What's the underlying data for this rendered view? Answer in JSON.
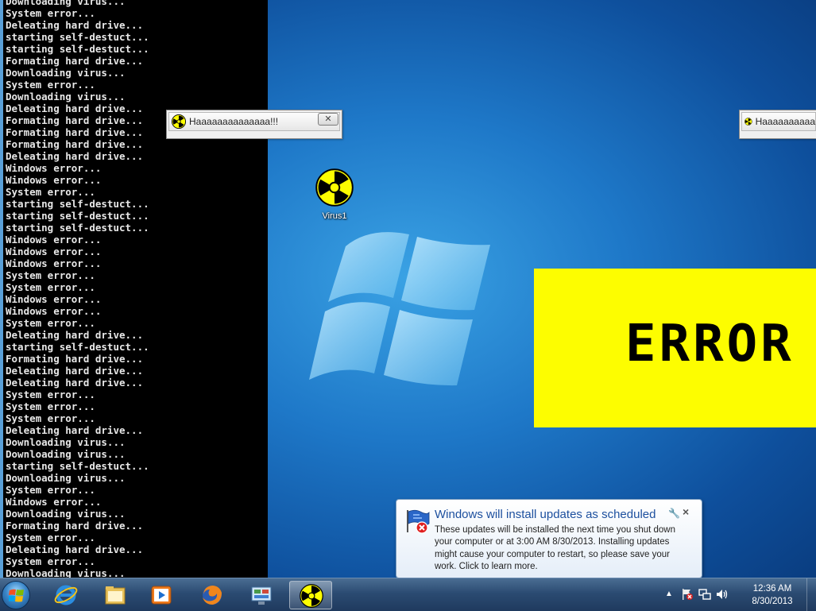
{
  "console": {
    "lines": [
      "Downloading virus...",
      "System error...",
      "Deleating hard drive...",
      "starting self-destuct...",
      "starting self-destuct...",
      "Formating hard drive...",
      "Downloading virus...",
      "System error...",
      "Downloading virus...",
      "Deleating hard drive...",
      "Formating hard drive...",
      "Formating hard drive...",
      "Formating hard drive...",
      "Deleating hard drive...",
      "Windows error...",
      "Windows error...",
      "System error...",
      "starting self-destuct...",
      "starting self-destuct...",
      "starting self-destuct...",
      "Windows error...",
      "Windows error...",
      "Windows error...",
      "System error...",
      "System error...",
      "Windows error...",
      "Windows error...",
      "System error...",
      "Deleating hard drive...",
      "starting self-destuct...",
      "Formating hard drive...",
      "Deleating hard drive...",
      "Deleating hard drive...",
      "System error...",
      "System error...",
      "System error...",
      "Deleating hard drive...",
      "Downloading virus...",
      "Downloading virus...",
      "starting self-destuct...",
      "Downloading virus...",
      "System error...",
      "Windows error...",
      "Downloading virus...",
      "Formating hard drive...",
      "System error...",
      "Deleating hard drive...",
      "System error...",
      "Downloading virus..."
    ]
  },
  "popups": [
    {
      "text": "Haaaaaaaaaaaaaa!!!"
    },
    {
      "text": "Haaaaaaaaaa"
    }
  ],
  "desktop_icon": {
    "label": "Virus1",
    "icon": "radiation-icon"
  },
  "error_box": {
    "text": "ERROR",
    "background": "#fdfd00"
  },
  "notification": {
    "title": "Windows will install updates as scheduled",
    "body": "These updates will be installed the next time you shut down your computer or at 3:00 AM 8/30/2013. Installing updates might cause your computer to restart, so please save your work. Click to learn more.",
    "icon": "windows-update-error-icon"
  },
  "taskbar": {
    "pinned": [
      {
        "name": "internet-explorer",
        "icon": "ie-icon"
      },
      {
        "name": "windows-explorer",
        "icon": "folder-icon"
      },
      {
        "name": "media-player",
        "icon": "media-player-icon"
      },
      {
        "name": "firefox",
        "icon": "firefox-icon"
      },
      {
        "name": "control-panel",
        "icon": "control-panel-icon"
      },
      {
        "name": "virus-app",
        "icon": "radiation-icon",
        "active": true
      }
    ],
    "clock": {
      "time": "12:36 AM",
      "date": "8/30/2013"
    }
  }
}
